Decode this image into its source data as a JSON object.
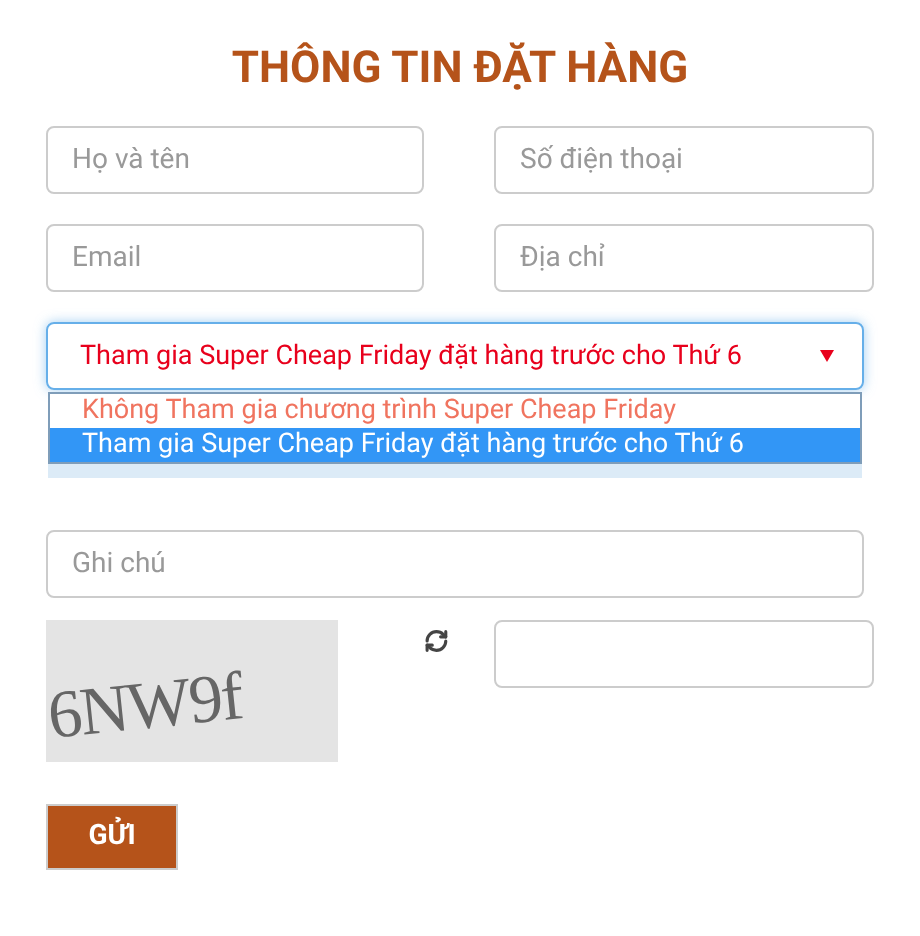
{
  "title": "THÔNG TIN ĐẶT HÀNG",
  "fields_row_1": [
    {
      "placeholder": "Họ và tên"
    },
    {
      "placeholder": "Số điện thoại"
    }
  ],
  "fields_row_2": [
    {
      "placeholder": "Email"
    },
    {
      "placeholder": "Địa chỉ"
    }
  ],
  "program_select": {
    "value": "Tham gia Super Cheap Friday đặt hàng trước cho Thứ 6",
    "expanded": true,
    "options": [
      {
        "label": "Không Tham gia chương trình Super Cheap Friday",
        "selected": false
      },
      {
        "label": "Tham gia Super Cheap Friday đặt hàng trước cho Thứ 6",
        "selected": true
      }
    ]
  },
  "note_field": {
    "placeholder": "Ghi chú"
  },
  "captcha": {
    "text": "6NW9f"
  },
  "submit_button": "GỬI"
}
